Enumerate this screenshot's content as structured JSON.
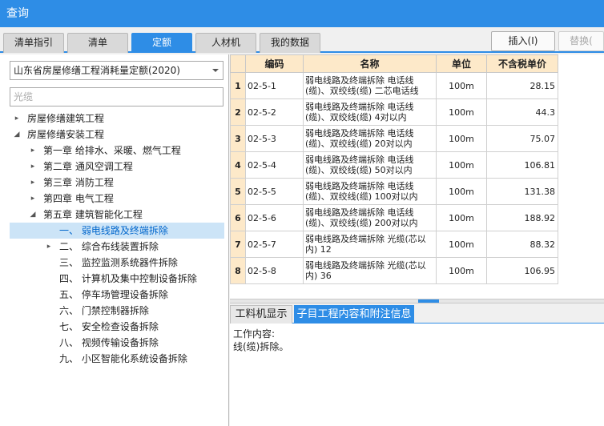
{
  "window": {
    "title": "查询"
  },
  "tabs": [
    {
      "label": "清单指引"
    },
    {
      "label": "清单"
    },
    {
      "label": "定额"
    },
    {
      "label": "人材机"
    },
    {
      "label": "我的数据"
    }
  ],
  "toolbar": {
    "insert_label": "插入(I)",
    "replace_label": "替换("
  },
  "quota_library": {
    "selected": "山东省房屋修缮工程消耗量定额(2020)"
  },
  "search": {
    "value": "光缆"
  },
  "tree": [
    {
      "label": "房屋修缮建筑工程",
      "arrow": "▸",
      "selected": false
    },
    {
      "label": "房屋修缮安装工程",
      "arrow": "◢",
      "selected": false
    },
    {
      "label": "第一章 给排水、采暖、燃气工程",
      "arrow": "▸",
      "selected": false
    },
    {
      "label": "第二章 通风空调工程",
      "arrow": "▸",
      "selected": false
    },
    {
      "label": "第三章 消防工程",
      "arrow": "▸",
      "selected": false
    },
    {
      "label": "第四章 电气工程",
      "arrow": "▸",
      "selected": false
    },
    {
      "label": "第五章 建筑智能化工程",
      "arrow": "◢",
      "selected": false
    },
    {
      "label": "一、 弱电线路及终端拆除",
      "arrow": "",
      "selected": true
    },
    {
      "label": "二、 综合布线装置拆除",
      "arrow": "▸",
      "selected": false
    },
    {
      "label": "三、 监控监测系统器件拆除",
      "arrow": "",
      "selected": false
    },
    {
      "label": "四、 计算机及集中控制设备拆除",
      "arrow": "",
      "selected": false
    },
    {
      "label": "五、 停车场管理设备拆除",
      "arrow": "",
      "selected": false
    },
    {
      "label": "六、 门禁控制器拆除",
      "arrow": "",
      "selected": false
    },
    {
      "label": "七、 安全检查设备拆除",
      "arrow": "",
      "selected": false
    },
    {
      "label": "八、 视频传输设备拆除",
      "arrow": "",
      "selected": false
    },
    {
      "label": "九、 小区智能化系统设备拆除",
      "arrow": "",
      "selected": false
    }
  ],
  "grid": {
    "columns": [
      "编码",
      "名称",
      "单位",
      "不含税单价"
    ],
    "rows": [
      {
        "num": "1",
        "code": "02-5-1",
        "name": "弱电线路及终端拆除 电话线(缆)、双绞线(缆) 二芯电话线",
        "unit": "100m",
        "price": "28.15"
      },
      {
        "num": "2",
        "code": "02-5-2",
        "name": "弱电线路及终端拆除 电话线(缆)、双绞线(缆) 4对以内",
        "unit": "100m",
        "price": "44.3"
      },
      {
        "num": "3",
        "code": "02-5-3",
        "name": "弱电线路及终端拆除 电话线(缆)、双绞线(缆) 20对以内",
        "unit": "100m",
        "price": "75.07"
      },
      {
        "num": "4",
        "code": "02-5-4",
        "name": "弱电线路及终端拆除 电话线(缆)、双绞线(缆) 50对以内",
        "unit": "100m",
        "price": "106.81"
      },
      {
        "num": "5",
        "code": "02-5-5",
        "name": "弱电线路及终端拆除 电话线(缆)、双绞线(缆) 100对以内",
        "unit": "100m",
        "price": "131.38"
      },
      {
        "num": "6",
        "code": "02-5-6",
        "name": "弱电线路及终端拆除 电话线(缆)、双绞线(缆) 200对以内",
        "unit": "100m",
        "price": "188.92"
      },
      {
        "num": "7",
        "code": "02-5-7",
        "name": "弱电线路及终端拆除 光缆(芯以内) 12",
        "unit": "100m",
        "price": "88.32"
      },
      {
        "num": "8",
        "code": "02-5-8",
        "name": "弱电线路及终端拆除 光缆(芯以内) 36",
        "unit": "100m",
        "price": "106.95"
      }
    ]
  },
  "bottom_tabs": [
    {
      "label": "工料机显示"
    },
    {
      "label": "子目工程内容和附注信息"
    }
  ],
  "info": {
    "heading": "工作内容:",
    "content": "线(缆)拆除。"
  },
  "colors": {
    "accent": "#2e8de6",
    "header_bg": "#fde9c9",
    "selection": "#cce4f7"
  },
  "icons": {
    "dropdown": "chevron-down-icon",
    "expand": "triangle-right-icon",
    "expanded": "triangle-down-icon"
  }
}
